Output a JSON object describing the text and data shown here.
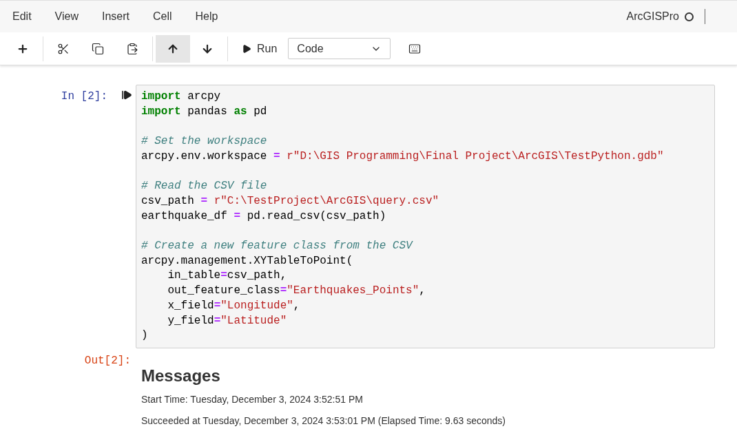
{
  "menu": [
    "Edit",
    "View",
    "Insert",
    "Cell",
    "Help"
  ],
  "kernel": {
    "name": "ArcGISPro",
    "busy": false
  },
  "toolbar": [
    {
      "kind": "add",
      "selected": false
    },
    {
      "kind": "separator"
    },
    {
      "kind": "cut",
      "selected": false
    },
    {
      "kind": "copy",
      "selected": false
    },
    {
      "kind": "paste",
      "selected": false
    },
    {
      "kind": "separator"
    },
    {
      "kind": "up",
      "selected": true
    },
    {
      "kind": "down",
      "selected": false
    },
    {
      "kind": "separator"
    },
    {
      "kind": "run",
      "label": "Run",
      "selected": false
    },
    {
      "kind": "select",
      "value": "Code"
    },
    {
      "kind": "keyboard",
      "selected": false
    }
  ],
  "cell": {
    "prompt": "In [2]:",
    "code": [
      {
        "kind": "code",
        "tokens": [
          {
            "kind": "keyword",
            "s": "import"
          },
          {
            "kind": "name",
            "s": " arcpy"
          }
        ]
      },
      {
        "kind": "code",
        "tokens": [
          {
            "kind": "keyword",
            "s": "import"
          },
          {
            "kind": "name",
            "s": " pandas "
          },
          {
            "kind": "keyword",
            "s": "as"
          },
          {
            "kind": "name",
            "s": " pd"
          }
        ]
      },
      {
        "kind": "blank"
      },
      {
        "kind": "code",
        "tokens": [
          {
            "kind": "comment",
            "s": "# Set the workspace"
          }
        ]
      },
      {
        "kind": "code",
        "tokens": [
          {
            "kind": "name",
            "s": "arcpy.env.workspace "
          },
          {
            "kind": "operator",
            "s": "="
          },
          {
            "kind": "string",
            "s": " r\"D:\\GIS Programming\\Final Project\\ArcGIS\\TestPython.gdb\""
          }
        ]
      },
      {
        "kind": "blank"
      },
      {
        "kind": "code",
        "tokens": [
          {
            "kind": "comment",
            "s": "# Read the CSV file"
          }
        ]
      },
      {
        "kind": "code",
        "tokens": [
          {
            "kind": "name",
            "s": "csv_path "
          },
          {
            "kind": "operator",
            "s": "="
          },
          {
            "kind": "string",
            "s": " r\"C:\\TestProject\\ArcGIS\\query.csv\""
          }
        ]
      },
      {
        "kind": "code",
        "tokens": [
          {
            "kind": "name",
            "s": "earthquake_df "
          },
          {
            "kind": "operator",
            "s": "="
          },
          {
            "kind": "name",
            "s": " pd.read_csv(csv_path)"
          }
        ]
      },
      {
        "kind": "blank"
      },
      {
        "kind": "code",
        "tokens": [
          {
            "kind": "comment",
            "s": "# Create a new feature class from the CSV"
          }
        ]
      },
      {
        "kind": "code",
        "tokens": [
          {
            "kind": "name",
            "s": "arcpy.management.XYTableToPoint("
          }
        ]
      },
      {
        "kind": "code",
        "tokens": [
          {
            "kind": "name",
            "s": "    in_table"
          },
          {
            "kind": "operator",
            "s": "="
          },
          {
            "kind": "name",
            "s": "csv_path,"
          }
        ]
      },
      {
        "kind": "code",
        "tokens": [
          {
            "kind": "name",
            "s": "    out_feature_class"
          },
          {
            "kind": "operator",
            "s": "="
          },
          {
            "kind": "string",
            "s": "\"Earthquakes_Points\""
          },
          {
            "kind": "name",
            "s": ","
          }
        ]
      },
      {
        "kind": "code",
        "tokens": [
          {
            "kind": "name",
            "s": "    x_field"
          },
          {
            "kind": "operator",
            "s": "="
          },
          {
            "kind": "string",
            "s": "\"Longitude\""
          },
          {
            "kind": "name",
            "s": ","
          }
        ]
      },
      {
        "kind": "code",
        "tokens": [
          {
            "kind": "name",
            "s": "    y_field"
          },
          {
            "kind": "operator",
            "s": "="
          },
          {
            "kind": "string",
            "s": "\"Latitude\""
          }
        ]
      },
      {
        "kind": "code",
        "tokens": [
          {
            "kind": "name",
            "s": ")"
          }
        ]
      }
    ]
  },
  "output": {
    "prompt": "Out[2]:",
    "title": "Messages",
    "messages": [
      "Start Time: Tuesday, December 3, 2024 3:52:51 PM",
      "Succeeded at Tuesday, December 3, 2024 3:53:01 PM (Elapsed Time: 9.63 seconds)"
    ]
  }
}
